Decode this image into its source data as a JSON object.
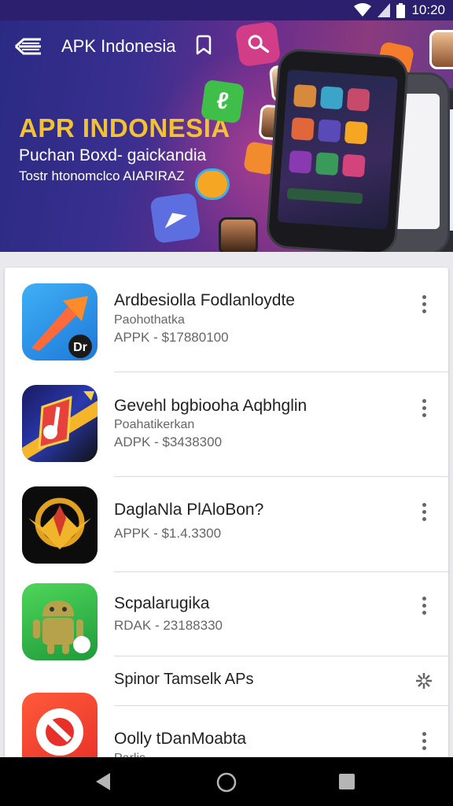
{
  "status_bar": {
    "time": "10:20"
  },
  "app_bar": {
    "title": "APK Indonesia"
  },
  "hero": {
    "title": "APR INDONESIA",
    "subtitle": "Puchan Boxd- gaickandia",
    "tagline": "Tostr htonomclco AIARIRAZ"
  },
  "apps": [
    {
      "name": "Ardbesiolla Fodlanloydte",
      "developer": "Paohothatka",
      "price": "APPK - $17880100"
    },
    {
      "name": "Gevehl bgbiooha Aqbhglin",
      "developer": "Poahatikerkan",
      "price": "ADPK - $3438300"
    },
    {
      "name": "DaglaNla PlAloBon?",
      "developer": "",
      "price": "APPK - $1.4.3300"
    },
    {
      "name": "Scpalarugika",
      "developer": "",
      "price": "RDAK - 23188330"
    }
  ],
  "section": {
    "label": "Spinor Tamselk APs"
  },
  "partial_app": {
    "name": "Oolly tDanMoabta",
    "developer": "Parlis..."
  },
  "colors": {
    "banner_start": "#2a2a83",
    "banner_end": "#8b3a7d",
    "hero_title": "#f2c233",
    "accent_pink": "#d23d88"
  },
  "icons": [
    "menu-icon",
    "bookmark-icon",
    "search-icon",
    "more-vert-icon",
    "settings-sparkle-icon",
    "back-icon",
    "home-icon",
    "recents-icon",
    "wifi-icon",
    "signal-icon",
    "battery-icon"
  ]
}
